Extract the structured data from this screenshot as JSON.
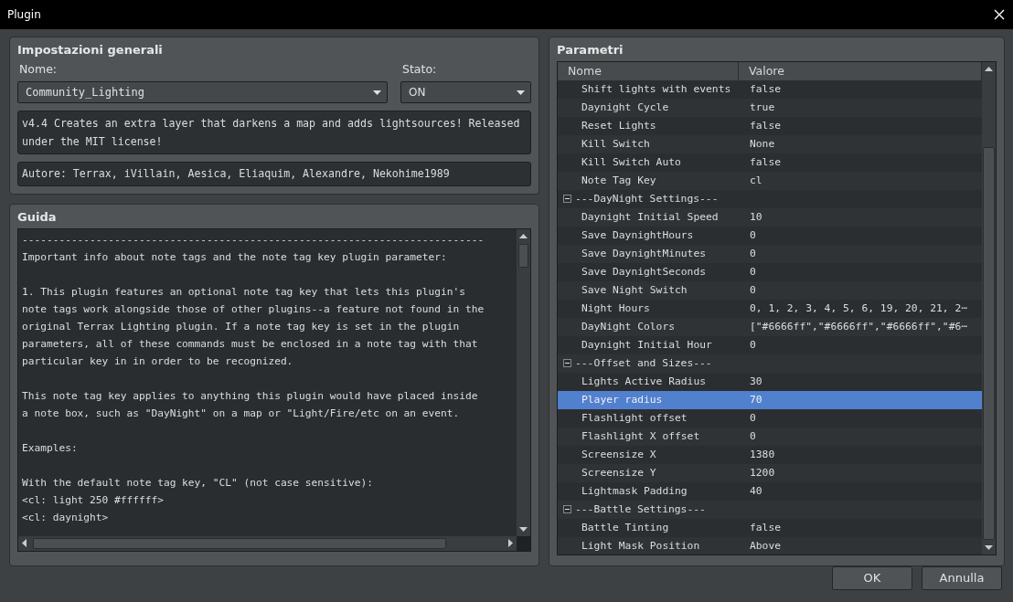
{
  "window": {
    "title": "Plugin"
  },
  "general": {
    "title": "Impostazioni generali",
    "name_label": "Nome:",
    "name_value": "Community_Lighting",
    "state_label": "Stato:",
    "state_value": "ON",
    "description": "v4.4 Creates an extra layer that darkens a map and adds lightsources! Released under the MIT license!",
    "author": "Autore: Terrax, iVillain, Aesica, Eliaquim, Alexandre, Nekohime1989"
  },
  "guide": {
    "title": "Guida",
    "paragraphs": [
      [
        "---------------------------------------------------------------------------",
        "Important info about note tags and the note tag key plugin parameter:"
      ],
      [
        "1. This plugin features an optional note tag key that lets this plugin's",
        "note tags work alongside those of other plugins--a feature not found in the",
        "original Terrax Lighting plugin. If a note tag key is set in the plugin",
        "parameters, all of these commands must be enclosed in a note tag with that",
        "particular key in in order to be recognized."
      ],
      [
        "This note tag key applies to anything this plugin would have placed inside",
        "a note box, such as \"DayNight\" on a map or \"Light/Fire/etc on an event."
      ],
      [
        "Examples:"
      ],
      [
        "With the default note tag key, \"CL\" (not case sensitive):",
        "<cl: light 250 #ffffff>",
        "<cl: daynight>"
      ]
    ]
  },
  "parameters": {
    "title": "Parametri",
    "columns": [
      "Nome",
      "Valore"
    ],
    "rows": [
      {
        "name": "Shift lights with events",
        "value": "false",
        "selected": false
      },
      {
        "name": "Daynight Cycle",
        "value": "true",
        "selected": false
      },
      {
        "name": "Reset Lights",
        "value": "false",
        "selected": false
      },
      {
        "name": "Kill Switch",
        "value": "None",
        "selected": false
      },
      {
        "name": "Kill Switch Auto",
        "value": "false",
        "selected": false
      },
      {
        "name": "Note Tag Key",
        "value": "cl",
        "selected": false
      },
      {
        "name": "---DayNight Settings---",
        "expanded": true,
        "children": [
          {
            "name": "Daynight Initial Speed",
            "value": "10",
            "selected": false
          },
          {
            "name": "Save DaynightHours",
            "value": "0",
            "selected": false
          },
          {
            "name": "Save DaynightMinutes",
            "value": "0",
            "selected": false
          },
          {
            "name": "Save DaynightSeconds",
            "value": "0",
            "selected": false
          },
          {
            "name": "Save Night Switch",
            "value": "0",
            "selected": false
          },
          {
            "name": "Night Hours",
            "value": "0, 1, 2, 3, 4, 5, 6, 19, 20, 21, 2⋯",
            "selected": false
          },
          {
            "name": "DayNight Colors",
            "value": "[\"#6666ff\",\"#6666ff\",\"#6666ff\",\"#6⋯",
            "selected": false
          },
          {
            "name": "Daynight Initial Hour",
            "value": "0",
            "selected": false
          }
        ]
      },
      {
        "name": "---Offset and Sizes---",
        "expanded": true,
        "children": [
          {
            "name": "Lights Active Radius",
            "value": "30",
            "selected": false
          },
          {
            "name": "Player radius",
            "value": "70",
            "selected": true
          },
          {
            "name": "Flashlight offset",
            "value": "0",
            "selected": false
          },
          {
            "name": "Flashlight X offset",
            "value": "0",
            "selected": false
          },
          {
            "name": "Screensize X",
            "value": "1380",
            "selected": false
          },
          {
            "name": "Screensize Y",
            "value": "1200",
            "selected": false
          },
          {
            "name": "Lightmask Padding",
            "value": "40",
            "selected": false
          }
        ]
      },
      {
        "name": "---Battle Settings---",
        "expanded": true,
        "children": [
          {
            "name": "Battle Tinting",
            "value": "false",
            "selected": false
          },
          {
            "name": "Light Mask Position",
            "value": "Above",
            "selected": false
          }
        ]
      }
    ]
  },
  "buttons": [
    "OK",
    "Annulla"
  ]
}
